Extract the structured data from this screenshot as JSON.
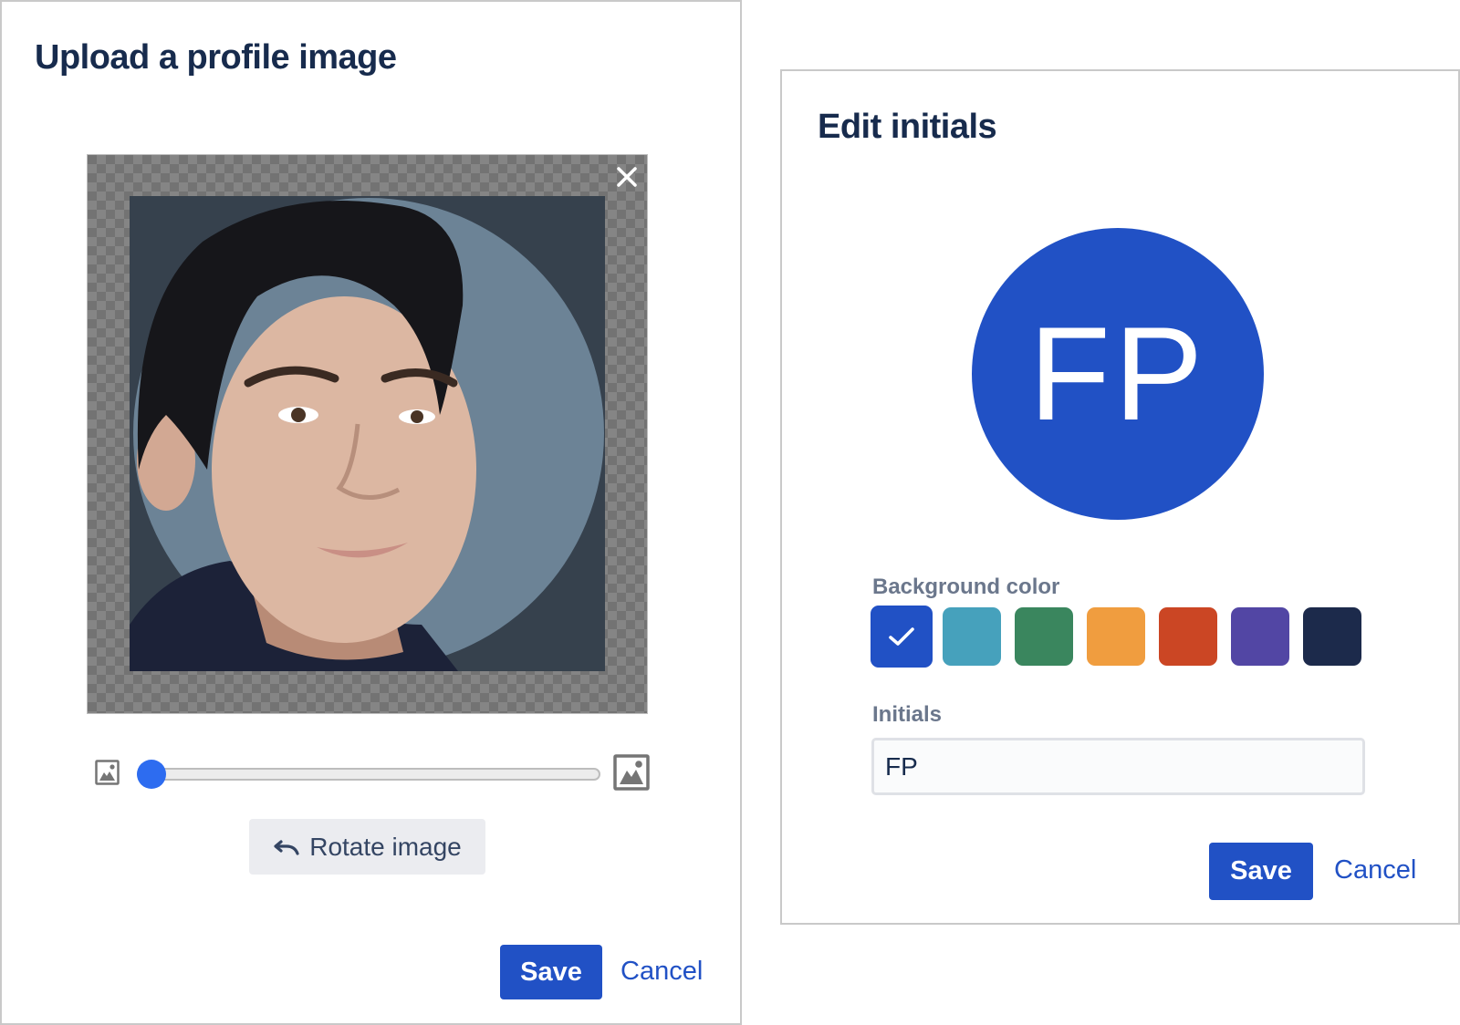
{
  "upload_dialog": {
    "title": "Upload a profile image",
    "close_icon": "close-icon",
    "zoom_slider": {
      "value_fraction": 0.0,
      "min_icon": "image-small-icon",
      "max_icon": "image-large-icon"
    },
    "rotate_button": {
      "icon": "rotate-left-icon",
      "label": "Rotate image"
    },
    "save_label": "Save",
    "cancel_label": "Cancel"
  },
  "initials_dialog": {
    "title": "Edit initials",
    "avatar_initials": "FP",
    "background_color_label": "Background color",
    "colors": [
      {
        "name": "blue",
        "hex": "#2151C5",
        "selected": true
      },
      {
        "name": "teal",
        "hex": "#46A1BC",
        "selected": false
      },
      {
        "name": "green",
        "hex": "#3A865E",
        "selected": false
      },
      {
        "name": "orange",
        "hex": "#F09D3F",
        "selected": false
      },
      {
        "name": "red",
        "hex": "#CB4624",
        "selected": false
      },
      {
        "name": "purple",
        "hex": "#5246A4",
        "selected": false
      },
      {
        "name": "navy",
        "hex": "#1C2A4B",
        "selected": false
      }
    ],
    "initials_label": "Initials",
    "initials_value": "FP",
    "save_label": "Save",
    "cancel_label": "Cancel"
  },
  "theme": {
    "primary": "#2151C5",
    "heading": "#172B4D",
    "label": "#6B778C",
    "slider_thumb": "#2D6CF0"
  }
}
